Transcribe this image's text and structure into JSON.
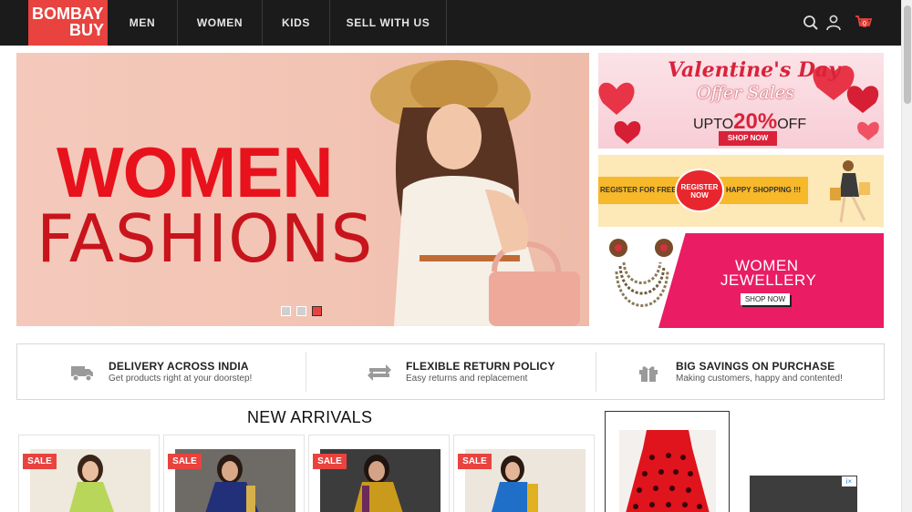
{
  "brand": {
    "line1": "BOMBAY",
    "line2": "BUY",
    "accent_color": "#e8433f",
    "header_bg": "#1b1b1b"
  },
  "nav": {
    "items": [
      {
        "label": "MEN"
      },
      {
        "label": "WOMEN"
      },
      {
        "label": "KIDS"
      },
      {
        "label": "SELL WITH US"
      }
    ]
  },
  "header_icons": {
    "search": "search-icon",
    "account": "user-icon",
    "cart": "cart-icon",
    "cart_count": "0"
  },
  "hero": {
    "title_line1": "WOMEN",
    "title_line2": "FASHIONS",
    "slides": 3,
    "active_slide": 3
  },
  "banners": {
    "valentine": {
      "title": "Valentine's Day",
      "subtitle": "Offer Sales",
      "upto": "UPTO",
      "discount": "20%",
      "off": "OFF",
      "cta": "SHOP NOW"
    },
    "register": {
      "left_text": "REGISTER FOR FREE",
      "button_line1": "REGISTER",
      "button_line2": "NOW",
      "right_text": "HAPPY SHOPPING !!!"
    },
    "jewellery": {
      "line1": "WOMEN",
      "line2": "JEWELLERY",
      "cta": "SHOP NOW"
    }
  },
  "features": [
    {
      "icon": "truck-icon",
      "title": "DELIVERY ACROSS INDIA",
      "subtitle": "Get products right at your doorstep!"
    },
    {
      "icon": "return-arrows-icon",
      "title": "FLEXIBLE RETURN POLICY",
      "subtitle": "Easy returns and replacement"
    },
    {
      "icon": "gift-icon",
      "title": "BIG SAVINGS ON PURCHASE",
      "subtitle": "Making customers, happy and contented!"
    }
  ],
  "new_arrivals": {
    "title": "NEW ARRIVALS",
    "products": [
      {
        "badge": "SALE"
      },
      {
        "badge": "SALE"
      },
      {
        "badge": "SALE"
      },
      {
        "badge": "SALE"
      }
    ]
  },
  "ad": {
    "badge": "i×"
  }
}
